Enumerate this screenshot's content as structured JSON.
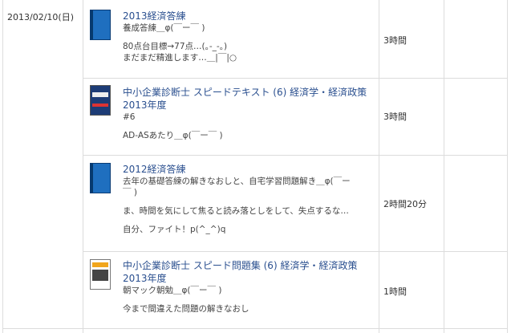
{
  "date": "2013/02/10(日)",
  "entries": [
    {
      "title": "2013経済答練",
      "lines": [
        "養成答練＿φ(￣ー￣ )",
        "",
        "80点台目標→77点…(｡-_-｡)",
        "まだまだ精進します…＿|￣|○"
      ],
      "duration": "3時間",
      "thumb": "blue-notebook-icon"
    },
    {
      "title": "中小企業診断士 スピードテキスト (6) 経済学・経済政策 2013年度",
      "lines": [
        "#6",
        "",
        "AD-ASあたり＿φ(￣ー￣ )"
      ],
      "duration": "3時間",
      "thumb": "textbook-cover"
    },
    {
      "title": "2012経済答練",
      "lines": [
        "去年の基礎答練の解きなおしと、自宅学習問題解き＿φ(￣ー",
        "￣ )",
        "",
        "ま、時間を気にして焦ると読み落としをして、失点するな…",
        "",
        "自分、ファイト！p(^_^)q"
      ],
      "duration": "2時間20分",
      "thumb": "blue-notebook-icon"
    },
    {
      "title": "中小企業診断士 スピード問題集 (6) 経済学・経済政策 2013年度",
      "lines": [
        "朝マック朝勉＿φ(￣ー￣ )",
        "",
        "今まで間違えた問題の解きなおし"
      ],
      "duration": "1時間",
      "thumb": "workbook-cover"
    }
  ]
}
